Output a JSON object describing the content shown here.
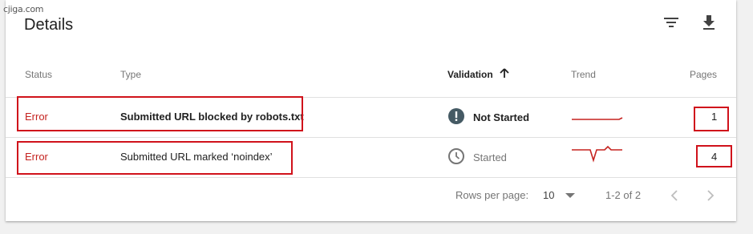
{
  "watermark": "cjiga.com",
  "card": {
    "title": "Details",
    "icons": {
      "filter": "filter-icon",
      "download": "download-icon"
    }
  },
  "table": {
    "headers": {
      "status": "Status",
      "type": "Type",
      "validation": "Validation",
      "trend": "Trend",
      "pages": "Pages"
    },
    "validation_sort_icon": "arrow-up-icon",
    "rows": [
      {
        "status": "Error",
        "type": "Submitted URL blocked by robots.txt",
        "validation": "Not Started",
        "validation_icon": "exclamation-circle-icon",
        "pages": "1"
      },
      {
        "status": "Error",
        "type": "Submitted URL marked ‘noindex’",
        "validation": "Started",
        "validation_icon": "clock-icon",
        "pages": "4"
      }
    ]
  },
  "pagination": {
    "rows_per_page_label": "Rows per page:",
    "rows_per_page_value": "10",
    "range": "1-2 of 2"
  },
  "colors": {
    "error": "#c5221f",
    "trend_line": "#c5221f",
    "highlight_box": "#d0121b",
    "icon_dark": "#455a64"
  }
}
